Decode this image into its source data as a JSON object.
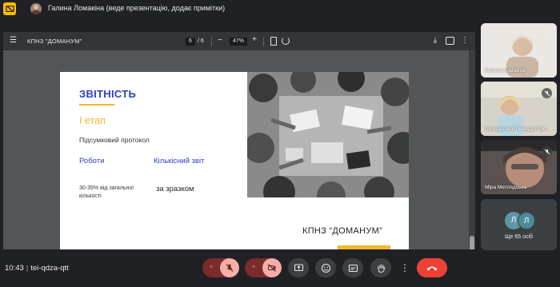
{
  "topbar": {
    "presenter_text": "Галина Ломакіна (веде презентацію, додає примітки)"
  },
  "pdf_toolbar": {
    "title": "КПНЗ \"ДОМАНУМ\"",
    "current_page": "6",
    "total_pages": "/  6",
    "zoom": "47%",
    "zoom_minus": "−",
    "zoom_plus": "+"
  },
  "slide": {
    "title": "ЗВІТНІСТЬ",
    "stage": "І етап",
    "protocol": "Підсумковий протокол",
    "works": "Роботи",
    "quantitative": "Кількісний звіт",
    "percent_text": "30-35% від загальної кількості",
    "by_sample": "за зразком",
    "org_name": "КПНЗ “ДОМАНУМ”"
  },
  "participants": [
    {
      "name": "Галина Ломакіна"
    },
    {
      "name": "Продаєська ТГ відділ ОК..."
    },
    {
      "name": "Міра Метлядська"
    }
  ],
  "others": {
    "avatar_letters": [
      "Л",
      "Л"
    ],
    "count_text": "Ще 65 осіб"
  },
  "meeting": {
    "time": "10:43",
    "divider": "|",
    "code": "tei-qdza-qtt"
  },
  "colors": {
    "accent_blue": "#2d3fc0",
    "accent_yellow": "#f1b82d",
    "hangup_red": "#ea4335",
    "muted_red": "#7a2b2b"
  },
  "icons": {
    "present": "present-screen-icon",
    "mic": "mic-off-icon",
    "camera": "camera-off-icon",
    "present_now": "present-now-icon",
    "emoji": "emoji-icon",
    "captions": "captions-icon",
    "hand": "raise-hand-icon",
    "more": "more-vert-icon",
    "hangup": "call-end-icon"
  }
}
